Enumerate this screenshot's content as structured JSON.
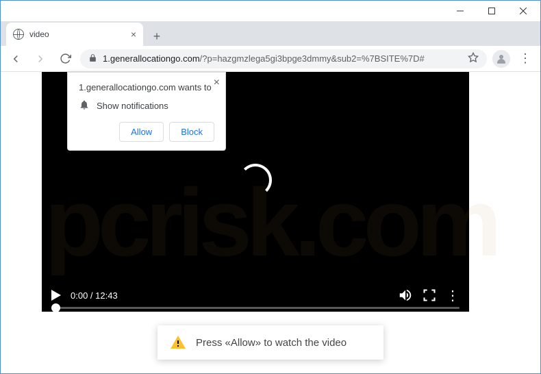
{
  "window": {
    "title": "video"
  },
  "tab": {
    "title": "video"
  },
  "toolbar": {
    "url_domain": "1.generallocationgo.com",
    "url_path": "/?p=hazgmzlega5gi3bpge3dmmy&sub2=%7BSITE%7D#"
  },
  "permission": {
    "heading": "1.generallocationgo.com wants to",
    "option": "Show notifications",
    "allow": "Allow",
    "block": "Block"
  },
  "video": {
    "current_time": "0:00",
    "duration": "12:43"
  },
  "bottom_message": "Press «Allow» to watch the video",
  "watermark": "pcrisk.com"
}
